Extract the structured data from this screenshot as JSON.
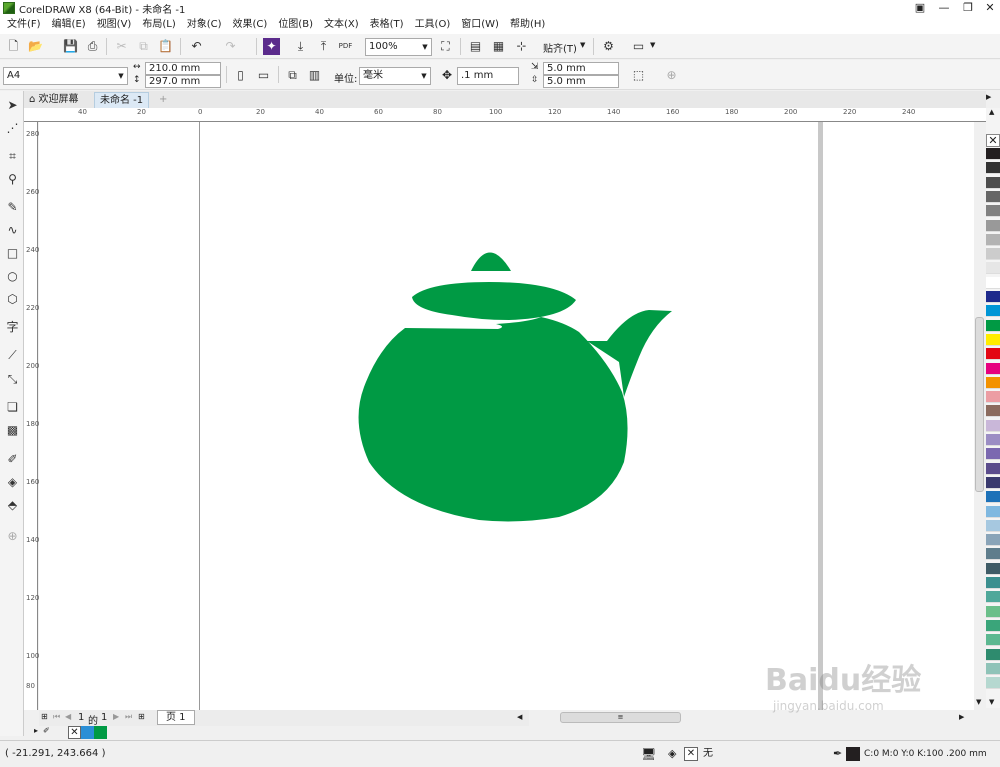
{
  "window": {
    "title": "CorelDRAW X8 (64-Bit) - 未命名 -1"
  },
  "menu": [
    "文件(F)",
    "编辑(E)",
    "视图(V)",
    "布局(L)",
    "对象(C)",
    "效果(C)",
    "位图(B)",
    "文本(X)",
    "表格(T)",
    "工具(O)",
    "窗口(W)",
    "帮助(H)"
  ],
  "toolbar": {
    "zoom": "100%",
    "pdf_label": "PDF",
    "snap_label": "贴齐(T)"
  },
  "property_bar": {
    "page_size": "A4",
    "width": "210.0 mm",
    "height": "297.0 mm",
    "unit_label": "单位:",
    "unit_value": "毫米",
    "nudge": ".1 mm",
    "dup_x": "5.0 mm",
    "dup_y": "5.0 mm"
  },
  "tabs": {
    "welcome": "欢迎屏幕",
    "document": "未命名 -1"
  },
  "ruler_h": [
    "40",
    "20",
    "0",
    "20",
    "40",
    "60",
    "80",
    "100",
    "120",
    "140",
    "160",
    "180",
    "200",
    "220",
    "240"
  ],
  "ruler_v": [
    "280",
    "260",
    "240",
    "220",
    "200",
    "180",
    "160",
    "140",
    "120",
    "100",
    "80"
  ],
  "page_nav": {
    "current": "1",
    "of_label": "的",
    "total": "1",
    "page_tab": "页 1"
  },
  "status": {
    "cursor_coords": "( -21.291, 243.664 )",
    "fill_none": "无",
    "outline_info": "C:0 M:0 Y:0 K:100  .200 mm"
  },
  "colors": {
    "teapot_fill": "#009a44",
    "accent_blue": "#2b8fd6"
  },
  "palette_colors": [
    "#231f20",
    "#333333",
    "#4d4d4d",
    "#666666",
    "#808080",
    "#999999",
    "#b3b3b3",
    "#cccccc",
    "#e6e6e6",
    "#ffffff",
    "#1e2a8c",
    "#0096d6",
    "#009a44",
    "#ffed00",
    "#e30613",
    "#e6007e",
    "#f39200",
    "#ec9da3",
    "#8b6b5e",
    "#c9b7d9",
    "#9b8dc4",
    "#7b68b0",
    "#5b4c8c",
    "#3a3a6e",
    "#1d71b8",
    "#7fb8e0",
    "#a6c8e0",
    "#8aa4b8",
    "#5f7d8c",
    "#3f5b66",
    "#3b8f8f",
    "#4fa89a",
    "#6bbf8a",
    "#3aa57a",
    "#5cb891",
    "#2e8b6e",
    "#8fc3b8",
    "#b5d8d0"
  ],
  "watermark": {
    "brand": "Baidu经验",
    "url": "jingyan.baidu.com"
  }
}
